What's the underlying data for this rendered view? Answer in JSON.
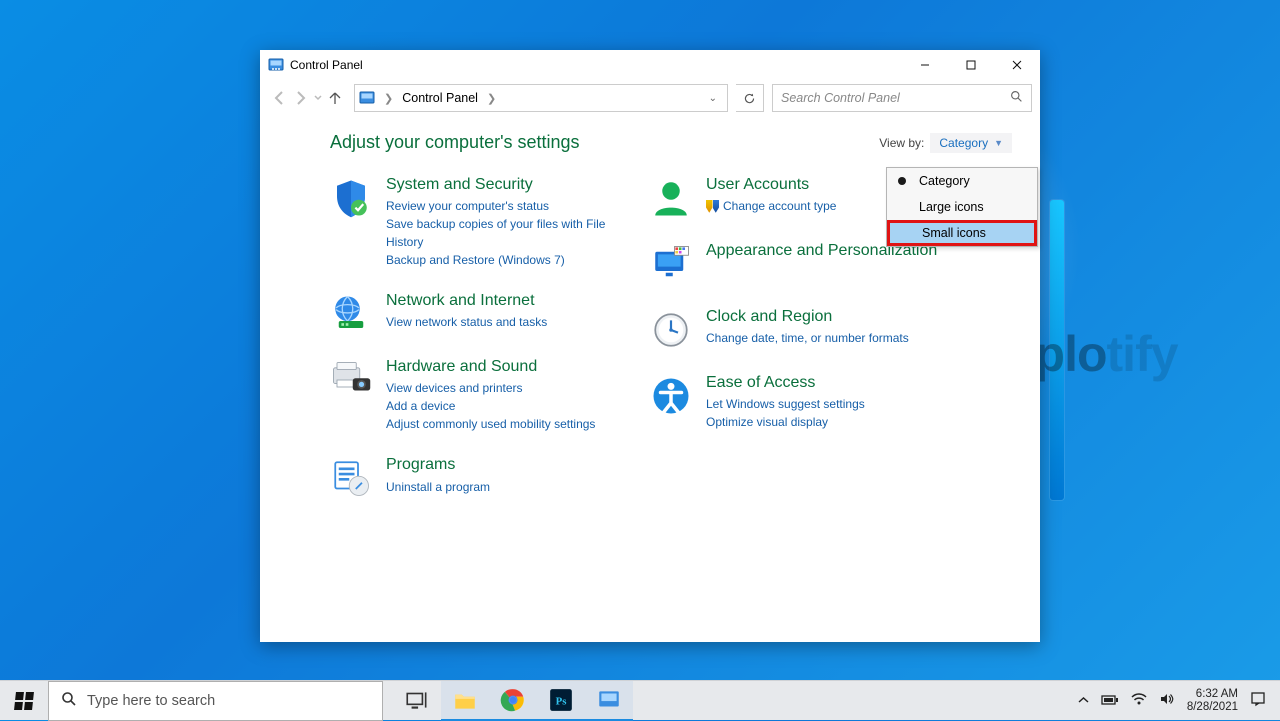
{
  "window": {
    "title": "Control Panel",
    "breadcrumb": "Control Panel",
    "search_placeholder": "Search Control Panel"
  },
  "heading": "Adjust your computer's settings",
  "viewby": {
    "label": "View by:",
    "value": "Category",
    "options": {
      "category": "Category",
      "large": "Large icons",
      "small": "Small icons"
    }
  },
  "categories": {
    "system_security": {
      "title": "System and Security",
      "link1": "Review your computer's status",
      "link2": "Save backup copies of your files with File History",
      "link3": "Backup and Restore (Windows 7)"
    },
    "network": {
      "title": "Network and Internet",
      "link1": "View network status and tasks"
    },
    "hardware": {
      "title": "Hardware and Sound",
      "link1": "View devices and printers",
      "link2": "Add a device",
      "link3": "Adjust commonly used mobility settings"
    },
    "programs": {
      "title": "Programs",
      "link1": "Uninstall a program"
    },
    "user_accounts": {
      "title": "User Accounts",
      "link1": "Change account type"
    },
    "appearance": {
      "title": "Appearance and Personalization"
    },
    "clock": {
      "title": "Clock and Region",
      "link1": "Change date, time, or number formats"
    },
    "ease": {
      "title": "Ease of Access",
      "link1": "Let Windows suggest settings",
      "link2": "Optimize visual display"
    }
  },
  "taskbar": {
    "search_hint": "Type here to search",
    "time": "6:32 AM",
    "date": "8/28/2021"
  },
  "watermark": {
    "a": "uplo",
    "b": "tify"
  }
}
